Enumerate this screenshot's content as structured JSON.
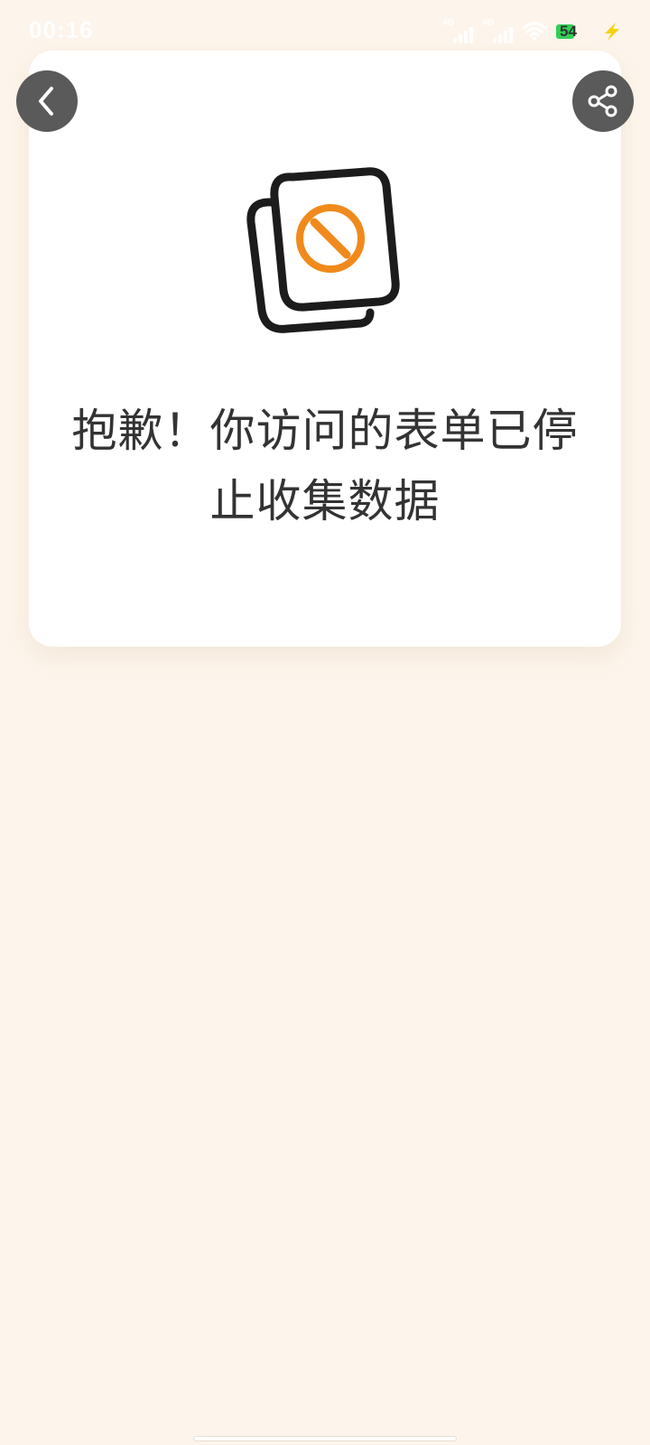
{
  "status_bar": {
    "time": "00:16",
    "signal1_tag": "4G",
    "signal2_tag": "4G",
    "battery_level": "54"
  },
  "nav": {
    "back_icon": "chevron-left-icon",
    "share_icon": "share-icon"
  },
  "main": {
    "illustration": "form-stopped-icon",
    "message": "抱歉！你访问的表单已停止收集数据"
  },
  "colors": {
    "background": "#fdf5ec",
    "card": "#ffffff",
    "button": "#5a5a5a",
    "accent": "#f08a1c",
    "text": "#333333"
  }
}
